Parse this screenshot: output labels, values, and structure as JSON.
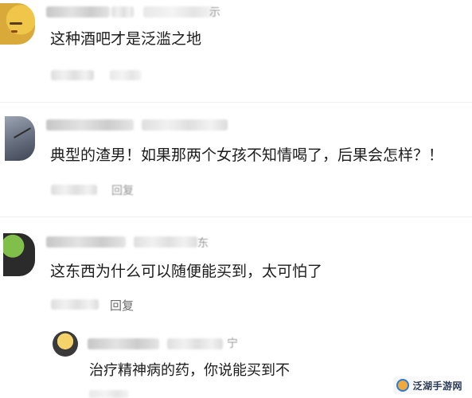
{
  "comments": [
    {
      "text": "这种酒吧才是泛滥之地",
      "faded_meta": "",
      "name_tail": "示"
    },
    {
      "text": "典型的渣男！如果那两个女孩不知情喝了，后果会怎样？！",
      "faded_meta": "回复"
    },
    {
      "text": "这东西为什么可以随便能买到，太可怕了",
      "reply_label": "回复",
      "name_tail": "东"
    }
  ],
  "sub_reply": {
    "text": "治疗精神病的药，你说能买到不",
    "name_tail": "宁"
  },
  "watermark": {
    "text": "泛湖手游网"
  },
  "colors": {
    "text": "#1c1c1c",
    "muted": "#6b6b6b",
    "watermark_orange": "#f2a93b",
    "watermark_blue": "#2a7bd6"
  },
  "icons": [
    "avatar",
    "watermark-logo"
  ]
}
